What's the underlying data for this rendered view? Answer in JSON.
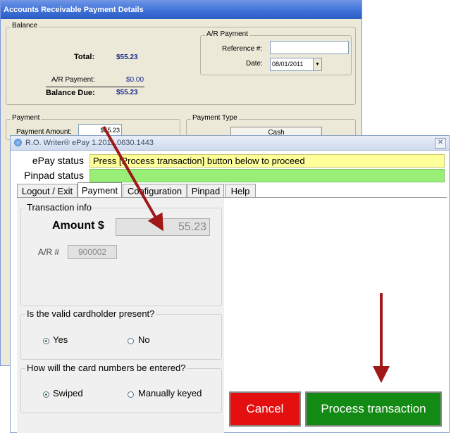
{
  "back_window": {
    "title": "Accounts Receivable Payment Details",
    "balance": {
      "legend": "Balance",
      "total_label": "Total:",
      "total_value": "$55.23",
      "ar_payment_label": "A/R Payment:",
      "ar_payment_value": "$0.00",
      "balance_due_label": "Balance Due:",
      "balance_due_value": "$55.23"
    },
    "ar_payment_group": {
      "legend": "A/R Payment",
      "reference_label": "Reference #:",
      "reference_value": "",
      "date_label": "Date:",
      "date_value": "08/01/2011"
    },
    "payment": {
      "legend": "Payment",
      "amount_label": "Payment Amount:",
      "amount_value": "$55.23"
    },
    "payment_type": {
      "legend": "Payment Type",
      "cash_label": "Cash"
    }
  },
  "front_window": {
    "title": "R.O. Writer® ePay 1.2011.0630.1443",
    "epay_status_label": "ePay status",
    "epay_status_value": "Press [Process transaction] button below to proceed",
    "pinpad_status_label": "Pinpad status",
    "pinpad_status_value": "",
    "tabs": [
      "Logout / Exit",
      "Payment",
      "Configuration",
      "Pinpad",
      "Help"
    ],
    "active_tab": "Payment",
    "transaction_info": {
      "legend": "Transaction info",
      "amount_label": "Amount $",
      "amount_value": "55.23",
      "ar_label": "A/R #",
      "ar_value": "900002"
    },
    "cardholder": {
      "legend": "Is the valid cardholder present?",
      "options": [
        "Yes",
        "No"
      ],
      "selected": "Yes"
    },
    "card_entry": {
      "legend": "How will the card numbers be entered?",
      "options": [
        "Swiped",
        "Manually keyed"
      ],
      "selected": "Swiped"
    },
    "cancel_label": "Cancel",
    "process_label": "Process transaction"
  },
  "colors": {
    "epay_status_bg": "#ffff99",
    "pinpad_status_bg": "#99ee77",
    "cancel_bg": "#e41010",
    "process_bg": "#138a13",
    "arrow": "#a01818",
    "xp_title": "#3b6fd6"
  }
}
